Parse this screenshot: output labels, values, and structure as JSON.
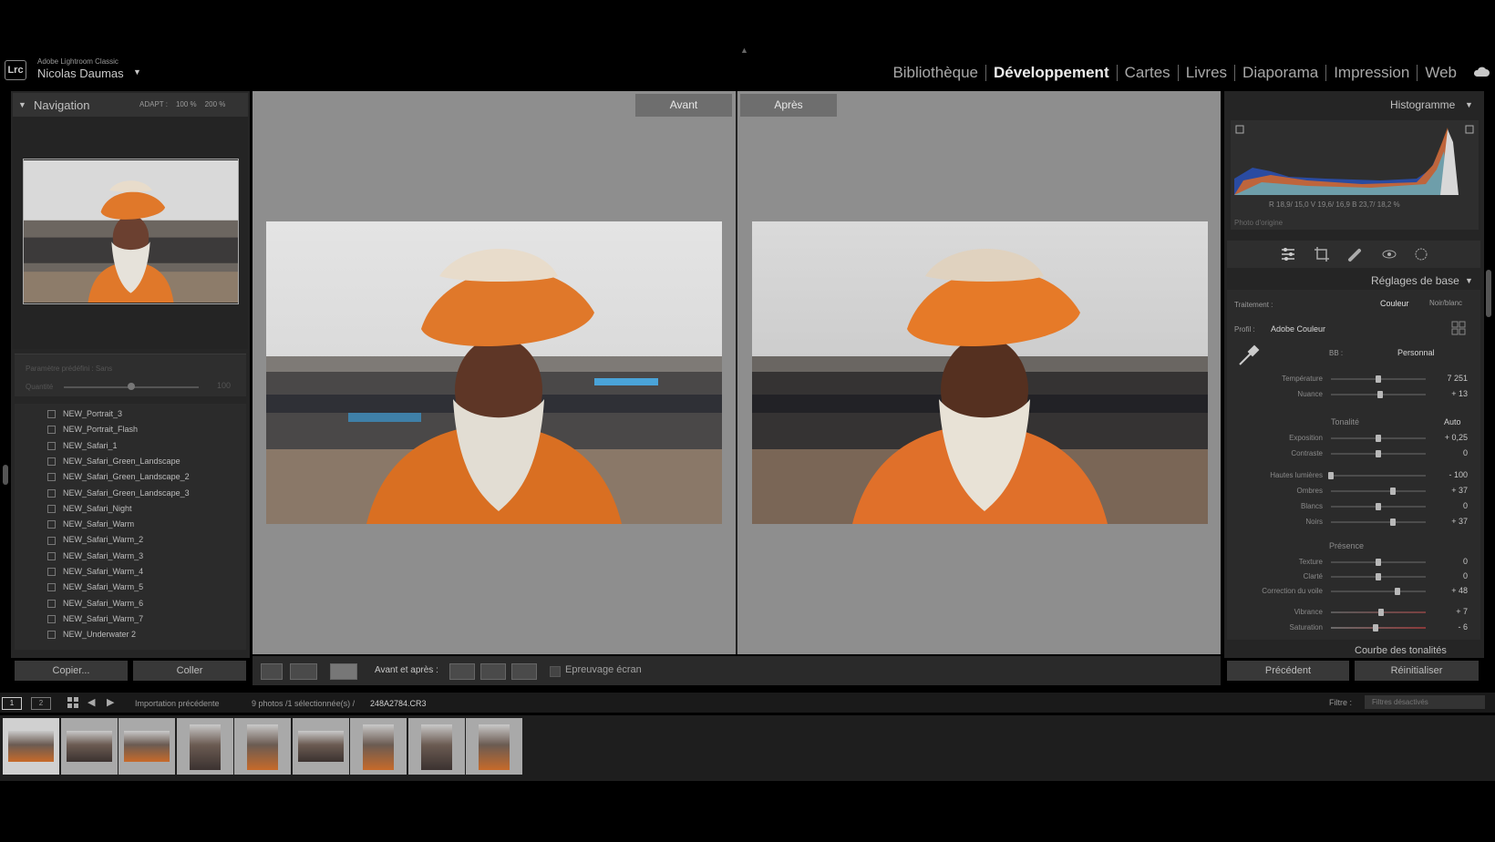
{
  "app": {
    "small_title": "Adobe Lightroom Classic",
    "user": "Nicolas Daumas",
    "logo": "Lrc"
  },
  "modules": [
    "Bibliothèque",
    "Développement",
    "Cartes",
    "Livres",
    "Diaporama",
    "Impression",
    "Web"
  ],
  "active_module": "Développement",
  "navigator": {
    "title": "Navigation",
    "zoom": [
      "ADAPT :",
      "100 %",
      "200 %"
    ]
  },
  "preset_amount": {
    "label": "Paramètre prédéfini : Sans",
    "quantity_label": "Quantité",
    "quantity_value": "100"
  },
  "presets": [
    "NEW_Portrait_3",
    "NEW_Portrait_Flash",
    "NEW_Safari_1",
    "NEW_Safari_Green_Landscape",
    "NEW_Safari_Green_Landscape_2",
    "NEW_Safari_Green_Landscape_3",
    "NEW_Safari_Night",
    "NEW_Safari_Warm",
    "NEW_Safari_Warm_2",
    "NEW_Safari_Warm_3",
    "NEW_Safari_Warm_4",
    "NEW_Safari_Warm_5",
    "NEW_Safari_Warm_6",
    "NEW_Safari_Warm_7",
    "NEW_Underwater 2"
  ],
  "left_buttons": {
    "copy": "Copier...",
    "paste": "Coller"
  },
  "compare": {
    "before": "Avant",
    "after": "Après"
  },
  "toolbar": {
    "before_after_label": "Avant et après :",
    "proof_label": "Epreuvage écran"
  },
  "histogram": {
    "title": "Histogramme",
    "readout": "R 18,9/ 15,0  V 19,6/ 16,9  B 23,7/ 18,2 %",
    "original_photo": "Photo d'origine"
  },
  "basic": {
    "title": "Réglages de base",
    "treatment_label": "Traitement :",
    "treatment_options": [
      "Couleur",
      "Noir/blanc"
    ],
    "profile_label": "Profil :",
    "profile_value": "Adobe Couleur",
    "wb_label": "BB :",
    "wb_value": "Personnal",
    "tone_label": "Tonalité",
    "auto": "Auto",
    "presence_label": "Présence",
    "next_section": "Courbe des tonalités"
  },
  "sliders": [
    {
      "name": "Température",
      "value": "7 251",
      "pos": 0.5
    },
    {
      "name": "Nuance",
      "value": "+ 13",
      "pos": 0.52
    },
    {
      "name": "Exposition",
      "value": "+ 0,25",
      "pos": 0.5
    },
    {
      "name": "Contraste",
      "value": "0",
      "pos": 0.5
    },
    {
      "name": "Hautes lumières",
      "value": "- 100",
      "pos": 0.0
    },
    {
      "name": "Ombres",
      "value": "+ 37",
      "pos": 0.65
    },
    {
      "name": "Blancs",
      "value": "0",
      "pos": 0.5
    },
    {
      "name": "Noirs",
      "value": "+ 37",
      "pos": 0.65
    },
    {
      "name": "Texture",
      "value": "0",
      "pos": 0.5
    },
    {
      "name": "Clarté",
      "value": "0",
      "pos": 0.5
    },
    {
      "name": "Correction du voile",
      "value": "+ 48",
      "pos": 0.7
    },
    {
      "name": "Vibrance",
      "value": "+ 7",
      "pos": 0.53
    },
    {
      "name": "Saturation",
      "value": "- 6",
      "pos": 0.47
    }
  ],
  "right_buttons": {
    "previous": "Précédent",
    "reset": "Réinitialiser"
  },
  "filmstrip": {
    "source": "Importation précédente",
    "count": "9 photos /1 sélectionnée(s) /",
    "file": "248A2784.CR3",
    "filter_label": "Filtre :",
    "filter_value": "Filtres désactivés",
    "screens": [
      "1",
      "2"
    ]
  },
  "colors": {
    "accent_orange": "#e0782a",
    "panel": "#2b2b2b",
    "center_bg": "#8e8e8e"
  }
}
